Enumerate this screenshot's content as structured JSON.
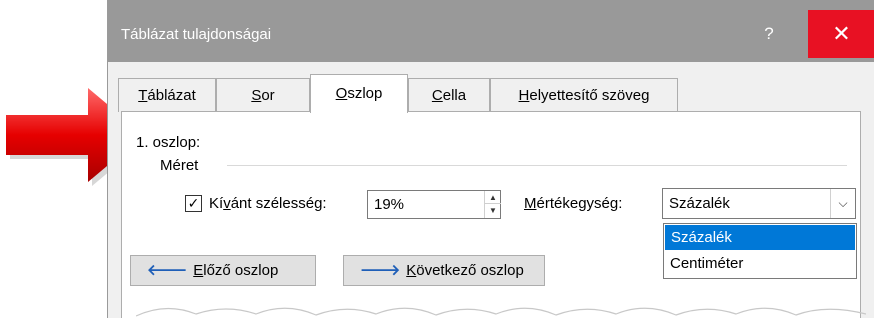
{
  "window": {
    "title": "Táblázat tulajdonságai",
    "help_label": "?",
    "close_label": "✕"
  },
  "tabs": [
    {
      "prefix": "",
      "accel": "T",
      "rest": "áblázat",
      "active": false
    },
    {
      "prefix": "",
      "accel": "S",
      "rest": "or",
      "active": false
    },
    {
      "prefix": "",
      "accel": "O",
      "rest": "szlop",
      "active": true
    },
    {
      "prefix": "",
      "accel": "C",
      "rest": "ella",
      "active": false
    },
    {
      "prefix": "",
      "accel": "H",
      "rest": "elyettesítő szöveg",
      "active": false
    }
  ],
  "column": {
    "label": "1. oszlop:",
    "size_label": "Méret",
    "preferred_width": {
      "checked": true,
      "check_glyph": "✓",
      "label_pre": "Kí",
      "label_accel": "v",
      "label_post": "ánt szélesség:",
      "value": "19%",
      "spin_up": "▲",
      "spin_down": "▼"
    },
    "unit": {
      "label_accel": "M",
      "label_post": "értékegység:",
      "selected": "Százalék",
      "chevron": "⌵",
      "options": [
        "Százalék",
        "Centiméter"
      ],
      "highlighted_index": 0
    }
  },
  "buttons": {
    "prev": {
      "icon": "🡐",
      "accel": "E",
      "rest": "lőző oszlop"
    },
    "next": {
      "icon": "🡒",
      "accel": "K",
      "rest": "övetkező oszlop"
    }
  },
  "colors": {
    "title_bar": "#999999",
    "close_red": "#e81123",
    "selection_blue": "#0078d7",
    "arrow_red": "#e60000"
  },
  "icons": {
    "arrow": "red-pointer-arrow-icon",
    "prev": "arrow-left-icon",
    "next": "arrow-right-icon"
  }
}
